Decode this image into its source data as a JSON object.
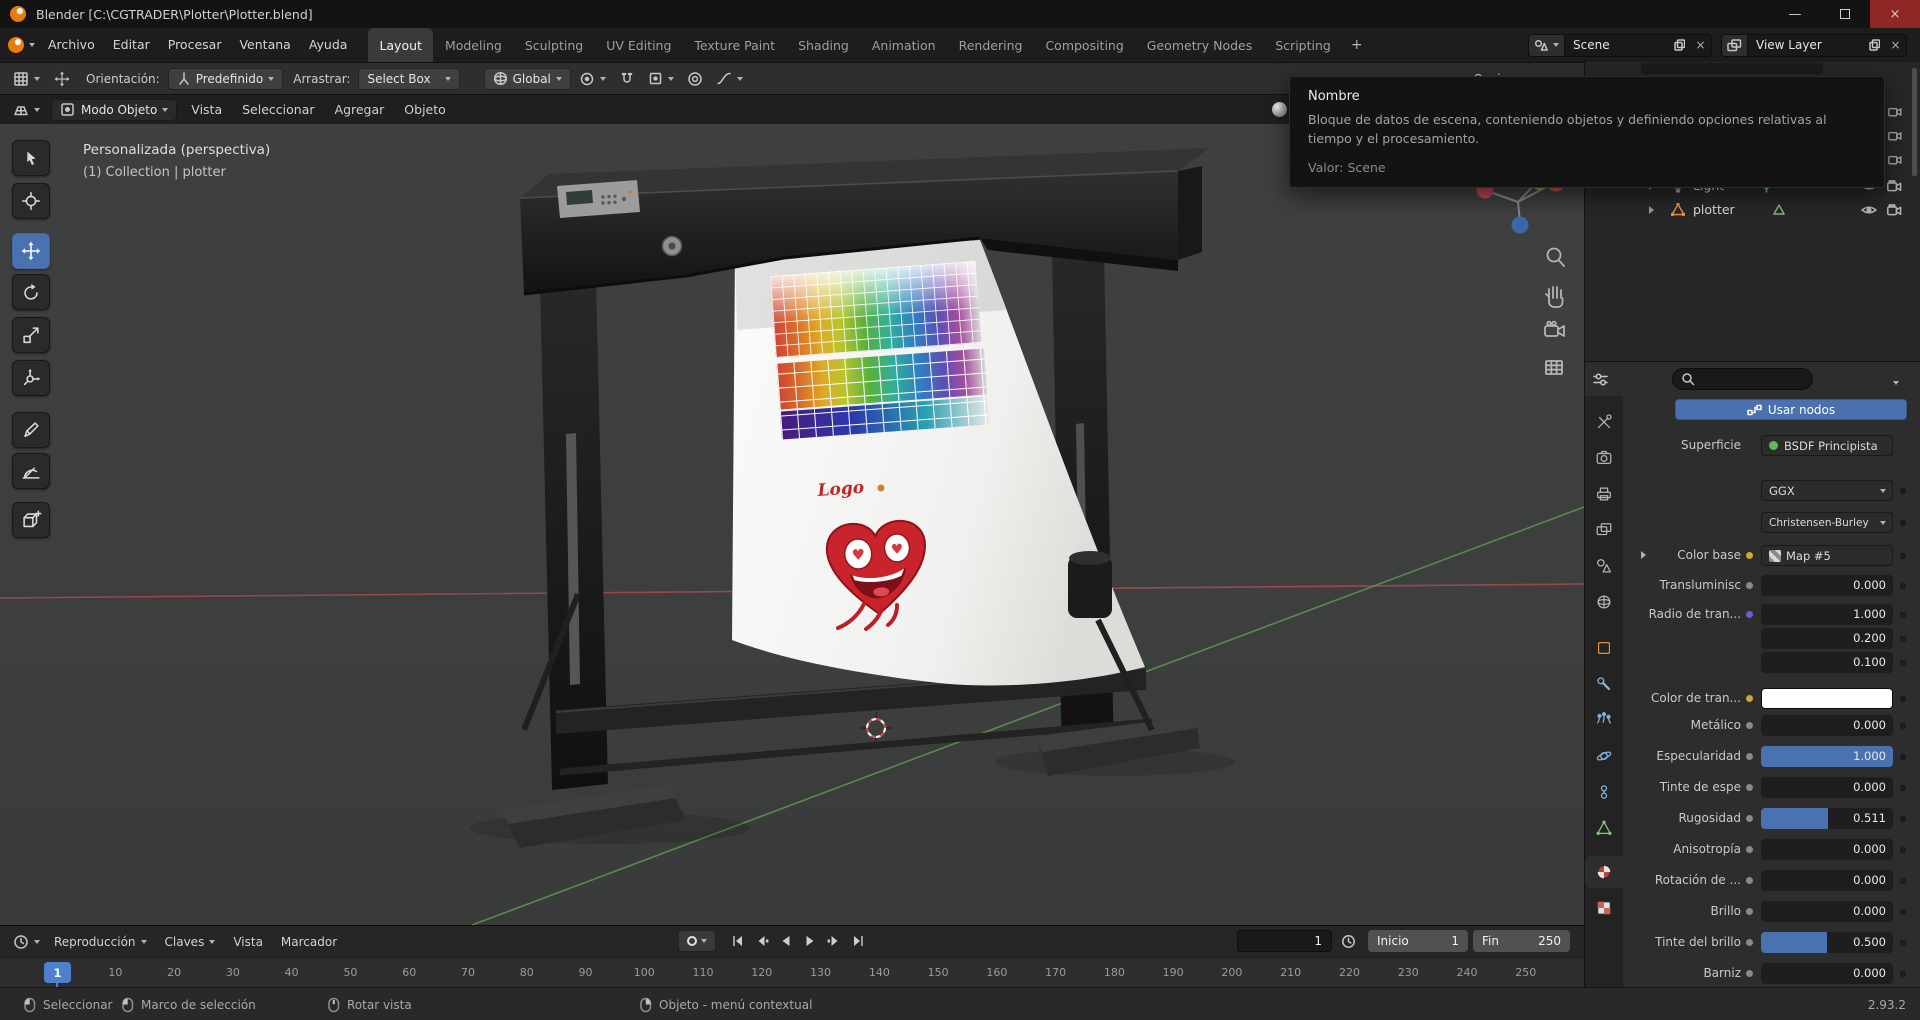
{
  "window": {
    "title": "Blender [C:\\CGTRADER\\Plotter\\Plotter.blend]",
    "controls": [
      "minimize-icon",
      "maximize-icon",
      "close-icon"
    ]
  },
  "menubar": {
    "menus": [
      "Archivo",
      "Editar",
      "Procesar",
      "Ventana",
      "Ayuda"
    ],
    "workspaces": [
      {
        "label": "Layout",
        "active": true
      },
      {
        "label": "Modeling"
      },
      {
        "label": "Sculpting"
      },
      {
        "label": "UV Editing"
      },
      {
        "label": "Texture Paint"
      },
      {
        "label": "Shading"
      },
      {
        "label": "Animation"
      },
      {
        "label": "Rendering"
      },
      {
        "label": "Compositing"
      },
      {
        "label": "Geometry Nodes"
      },
      {
        "label": "Scripting"
      }
    ],
    "add_workspace_label": "+",
    "scene_selector": {
      "value": "Scene"
    },
    "view_layer_selector": {
      "value": "View Layer"
    }
  },
  "tool_settings": {
    "orientation_label": "Orientación:",
    "orientation_value": "Predefinido",
    "drag_label": "Arrastrar:",
    "drag_value": "Select Box",
    "transform_orientation": "Global",
    "options_label": "Opciones"
  },
  "viewport": {
    "header": {
      "mode": "Modo Objeto",
      "menus": [
        "Vista",
        "Seleccionar",
        "Agregar",
        "Objeto"
      ]
    },
    "overlay": {
      "view_name": "Personalizada (perspectiva)",
      "context": "(1) Collection | plotter"
    },
    "tools": [
      "select-box-tool",
      "cursor-tool",
      "move-tool",
      "rotate-tool",
      "scale-tool",
      "transform-tool",
      "annotate-tool",
      "measure-tool",
      "add-cube-tool"
    ],
    "active_tool": "move-tool",
    "gizmo_x_label": "X",
    "paper_logo_text": "Logo"
  },
  "tooltip": {
    "title": "Nombre",
    "body": "Bloque de datos de escena, conteniendo objetos y definiendo opciones relativas al tiempo y el procesamiento.",
    "value": "Valor: Scene"
  },
  "outliner": {
    "items": [
      {
        "label": "Light",
        "icon": "light-icon"
      },
      {
        "label": "plotter",
        "icon": "mesh-icon"
      }
    ]
  },
  "properties": {
    "accent_color": "#4A72B0",
    "tab_icons": [
      "tool-icon",
      "render-icon",
      "output-icon",
      "view-layer-icon",
      "scene-icon",
      "world-icon",
      "object-icon",
      "modifiers-icon",
      "particles-icon",
      "physics-icon",
      "constraints-icon",
      "object-data-icon",
      "material-icon",
      "texture-icon"
    ],
    "active_tab": "material-icon",
    "use_nodes_label": "Usar nodos",
    "surface": {
      "label": "Superficie",
      "value": "BSDF Principista"
    },
    "distribution": "GGX",
    "subsurface_method": "Christensen-Burley",
    "base_color": {
      "label": "Color base",
      "value": "Map #5"
    },
    "subsurface": {
      "label": "Transluminisc",
      "value": "0.000",
      "fill": 0
    },
    "subsurface_radius": {
      "label": "Radio de tran...",
      "values": [
        "1.000",
        "0.200",
        "0.100"
      ]
    },
    "subsurface_color": {
      "label": "Color de tran...",
      "color": "#FFFFFF"
    },
    "sliders": [
      {
        "label": "Metálico",
        "value": "0.000",
        "fill": 0
      },
      {
        "label": "Especularidad",
        "value": "1.000",
        "fill": 1
      },
      {
        "label": "Tinte de espe",
        "value": "0.000",
        "fill": 0
      },
      {
        "label": "Rugosidad",
        "value": "0.511",
        "fill": 0.511
      },
      {
        "label": "Anisotropía",
        "value": "0.000",
        "fill": 0
      },
      {
        "label": "Rotación de ...",
        "value": "0.000",
        "fill": 0
      },
      {
        "label": "Brillo",
        "value": "0.000",
        "fill": 0
      },
      {
        "label": "Tinte del brillo",
        "value": "0.500",
        "fill": 0.5
      },
      {
        "label": "Barniz",
        "value": "0.000",
        "fill": 0
      }
    ]
  },
  "timeline": {
    "menus": [
      "Reproducción",
      "Claves",
      "Vista",
      "Marcador"
    ],
    "current_frame": "1",
    "start_label": "Inicio",
    "start_value": "1",
    "end_label": "Fin",
    "end_value": "250",
    "playhead": "1",
    "ruler": [
      "10",
      "20",
      "30",
      "40",
      "50",
      "60",
      "70",
      "80",
      "90",
      "100",
      "110",
      "120",
      "130",
      "140",
      "150",
      "160",
      "170",
      "180",
      "190",
      "200",
      "210",
      "220",
      "230",
      "240",
      "250"
    ]
  },
  "statusbar": {
    "items": [
      {
        "icon": "mouse-left-click-icon",
        "label": "Seleccionar"
      },
      {
        "icon": "mouse-left-drag-icon",
        "label": "Marco de selección"
      },
      {
        "icon": "mouse-middle-drag-icon",
        "label": "Rotar vista"
      },
      {
        "icon": "mouse-right-click-icon",
        "label": "Objeto - menú contextual"
      }
    ],
    "version": "2.93.2"
  }
}
